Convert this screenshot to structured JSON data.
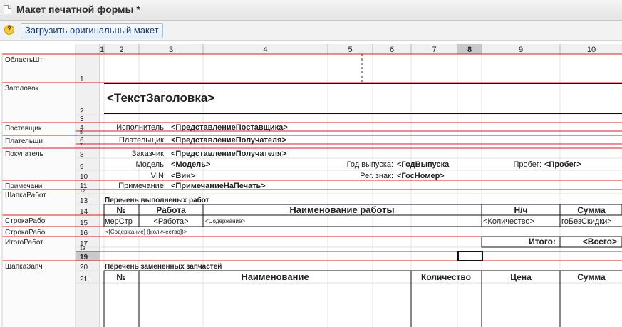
{
  "window": {
    "title": "Макет печатной формы *"
  },
  "toolbar": {
    "help_icon": "question-icon",
    "load_button": "Загрузить оригинальный макет"
  },
  "columns": [
    "1",
    "2",
    "3",
    "4",
    "5",
    "6",
    "7",
    "8",
    "9",
    "10"
  ],
  "selected_column": "8",
  "rows": [
    {
      "num": "1",
      "area": "ОбластьШт"
    },
    {
      "num": "2",
      "area": "Заголовок"
    },
    {
      "num": "3",
      "area": ""
    },
    {
      "num": "4",
      "area": "Поставщик"
    },
    {
      "num": "5",
      "area": ""
    },
    {
      "num": "6",
      "area": "Плательщи"
    },
    {
      "num": "7",
      "area": ""
    },
    {
      "num": "8",
      "area": "Покупатель"
    },
    {
      "num": "9",
      "area": ""
    },
    {
      "num": "10",
      "area": ""
    },
    {
      "num": "11",
      "area": "Примечани"
    },
    {
      "num": "12",
      "area": "ШапкаРабот"
    },
    {
      "num": "13",
      "area": ""
    },
    {
      "num": "14",
      "area": ""
    },
    {
      "num": "15",
      "area": "СтрокаРабо"
    },
    {
      "num": "16",
      "area": "СтрокаРабо"
    },
    {
      "num": "17",
      "area": "ИтогоРабот"
    },
    {
      "num": "18",
      "area": ""
    },
    {
      "num": "19",
      "area": ""
    },
    {
      "num": "20",
      "area": "ШапкаЗапч"
    },
    {
      "num": "21",
      "area": ""
    }
  ],
  "selected_row": "19",
  "cells": {
    "header_text": "<ТекстЗаголовка>",
    "executor_label": "Исполнитель:",
    "executor_value": "<ПредставлениеПоставщика>",
    "payer_label": "Плательщик:",
    "payer_value": "<ПредставлениеПолучателя>",
    "customer_label": "Заказчик:",
    "customer_value": "<ПредставлениеПолучателя>",
    "model_label": "Модель:",
    "model_value": "<Модель>",
    "year_label": "Год выпуска:",
    "year_value": "<ГодВыпуска",
    "mileage_label": "Пробег:",
    "mileage_value": "<Пробег>",
    "vin_label": "VIN:",
    "vin_value": "<Вин>",
    "reg_label": "Рег. знак:",
    "reg_value": "<ГосНомер>",
    "note_label": "Примечание:",
    "note_value": "<ПримечаниеНаПечать>",
    "works_title": "Перечень выполненых работ",
    "works_header_no": "№",
    "works_header_work": "Работа",
    "works_header_name": "Наименование работы",
    "works_header_nh": "Н/ч",
    "works_header_sum": "Сумма",
    "row15_no": "мерСтр",
    "row15_work": "<Работа>",
    "row15_content": "<Содержание>",
    "row15_qty": "<Количество>",
    "row15_sum": "гоБезСкидки>",
    "row16_text": "<[Содержание] ([количество])>",
    "total_label": "Итого:",
    "total_value": "<Всего>",
    "parts_title": "Перечень замененных запчастей",
    "parts_header_no": "№",
    "parts_header_name": "Наименование",
    "parts_header_qty": "Количество",
    "parts_header_price": "Цена",
    "parts_header_sum": "Сумма"
  },
  "colors": {
    "red_line": "#d42020",
    "grid": "#cfcfcf",
    "header_bg": "#f0f0f0"
  }
}
